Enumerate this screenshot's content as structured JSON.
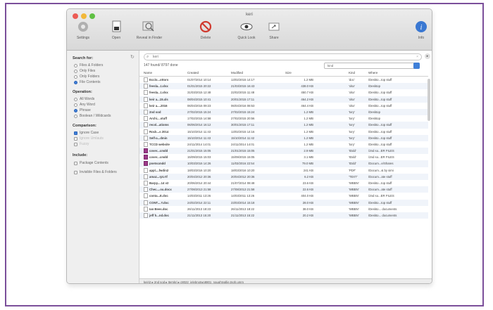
{
  "window": {
    "title": "keri"
  },
  "toolbar": {
    "settings": "Settings",
    "open": "Open",
    "reveal": "Reveal in Finder",
    "delete": "Delete",
    "quicklook": "Quick Look",
    "share": "Share",
    "info": "Info"
  },
  "sidebar": {
    "search_for": "Search for:",
    "search_opts": [
      "Files & Folders",
      "Only Files",
      "Only Folders",
      "File Contents"
    ],
    "operation": "Operation:",
    "op_opts": [
      "All Words",
      "Any Word",
      "Phrase",
      "Boolean / Wildcards"
    ],
    "comparison": "Comparison:",
    "cmp_opts": [
      "Ignore Case",
      "Ignore Umlauts",
      "Fuzzy"
    ],
    "include": "Include:",
    "inc_opts": [
      "Package Contents",
      "Invisible Files & Folders"
    ]
  },
  "search": {
    "value": "keri"
  },
  "status": "147 found/ 8797 done",
  "kind_select": "kind",
  "columns": [
    "Name",
    "Created",
    "Modified",
    "Size",
    "Kind",
    "Where"
  ],
  "rows": [
    [
      "Ecclo...ottors",
      "01/07/2014 10:14",
      "13/02/2015 14:17",
      "1.2 MB",
      "'doc'",
      "/Deskto...top stuff",
      "doc"
    ],
    [
      "feesla...t.xlsx",
      "01/01/2015 20:22",
      "21/03/2015 16:43",
      "438.0 KB",
      "'xlsx'",
      "/Desktop",
      "doc"
    ],
    [
      "feesla...t.xlsx",
      "31/03/2015 12:48",
      "22/02/2015 11:48",
      "450.7 KB",
      "'xlsx'",
      "/Deskto...top stuff",
      "doc"
    ],
    [
      "keir a...15.xls",
      "08/04/2015 10:41",
      "20/01/2015 17:11",
      "464.2 KB",
      "'xlsx'",
      "/Deskto...top stuff",
      "doc"
    ],
    [
      "keir a....2016",
      "06/04/2016 09:23",
      "06/04/2016 08:53",
      "464.4 KB",
      "'xlsx'",
      "/Deskto...top stuff",
      "doc"
    ],
    [
      "2nd sod",
      "27/02/2015 15:24",
      "27/02/2015 15:24",
      "1.2 MB",
      "'tory'",
      "/Desktop",
      "doc"
    ],
    [
      "Archi....stuff",
      "17/02/2015 14:58",
      "27/02/2015 20:56",
      "1.2 MB",
      "'tory'",
      "/Desktop",
      "doc"
    ],
    [
      "recol...atioms",
      "06/06/2014 16:12",
      "30/01/2015 17:11",
      "1.2 MB",
      "'tory'",
      "/Deskto...top stuff",
      "doc"
    ],
    [
      "Rock...s 2014",
      "15/10/2014 11:43",
      "13/02/2015 14:16",
      "1.2 MB",
      "'tory'",
      "/Deskto...top stuff",
      "doc"
    ],
    [
      "Self-a...dmin",
      "15/10/2014 11:43",
      "15/10/2014 11:42",
      "1.2 MB",
      "'tory'",
      "/Deskto...top stuff",
      "doc"
    ],
    [
      "TCCD website",
      "24/11/2014 14:01",
      "24/11/2014 14:01",
      "1.2 MB",
      "'tory'",
      "/Deskto...top stuff",
      "doc"
    ],
    [
      "cover...cmdd",
      "21/01/2015 15:05",
      "21/01/2015 15:05",
      "2.9 MB",
      "'IDdd'",
      "/2nd so...ER FILES",
      "pdf"
    ],
    [
      "cover...cmdd",
      "15/09/2015 15:03",
      "15/09/2015 15:05",
      "3.1 MB",
      "'IDdd'",
      "/2nd so...ER FILES",
      "pdf"
    ],
    [
      "pnetscmdd",
      "10/03/2016 14:26",
      "11/03/2016 22:54",
      "79.0 MB",
      "'IDdd'",
      "/Docum...e/Shares",
      "pdf"
    ],
    [
      "appl....fwdin2",
      "18/03/2016 10:20",
      "18/03/2016 10:20",
      "241 KB",
      "'PDF'",
      "/Docum...& by simi",
      "doc"
    ],
    [
      "amaz...rpt.rtf",
      "20/04/2012 20:36",
      "20/04/2012 20:36",
      "6.2 KB",
      "'TEXT'",
      "/Docum...ate stuff",
      "doc"
    ],
    [
      "Barpy....14 v2",
      "20/06/2014 20:44",
      "21/07/2014 08:48",
      "23.6 KB",
      "'WBBN'",
      "/Deskto...top stuff",
      "doc"
    ],
    [
      "Chec....ou.docx",
      "27/08/2013 21:58",
      "27/08/2013 21:58",
      "22.6 KB",
      "'WBBN'",
      "/Docum...ate stuff",
      "doc"
    ],
    [
      "conta...E.doc",
      "14/03/2011 13:26",
      "14/03/2011 13:26",
      "404.0 KB",
      "'WBBN'",
      "/2nd so...ER FILES",
      "doc"
    ],
    [
      "CONT....Y.doc",
      "24/02/2014 22:11",
      "23/03/2014 15:18",
      "28.0 KB",
      "'WBBN'",
      "/Deskto...top stuff",
      "doc"
    ],
    [
      "Ian Bees.doc",
      "26/11/2013 18:23",
      "26/11/2013 18:22",
      "38.0 KB",
      "'WBBN'",
      "/Deskto... documents",
      "doc"
    ],
    [
      "jeff h...nd.doc",
      "21/11/2013 15:20",
      "21/11/2013 15:22",
      "20.2 KB",
      "'WBBN'",
      "/Deskto... documents",
      "doc"
    ]
  ],
  "pathbar": "keiri2 ▸ 2nd sod ▸ Itemkri ▸ c8022_jelebnotwo8801_naughtyallie.tngh.umm"
}
